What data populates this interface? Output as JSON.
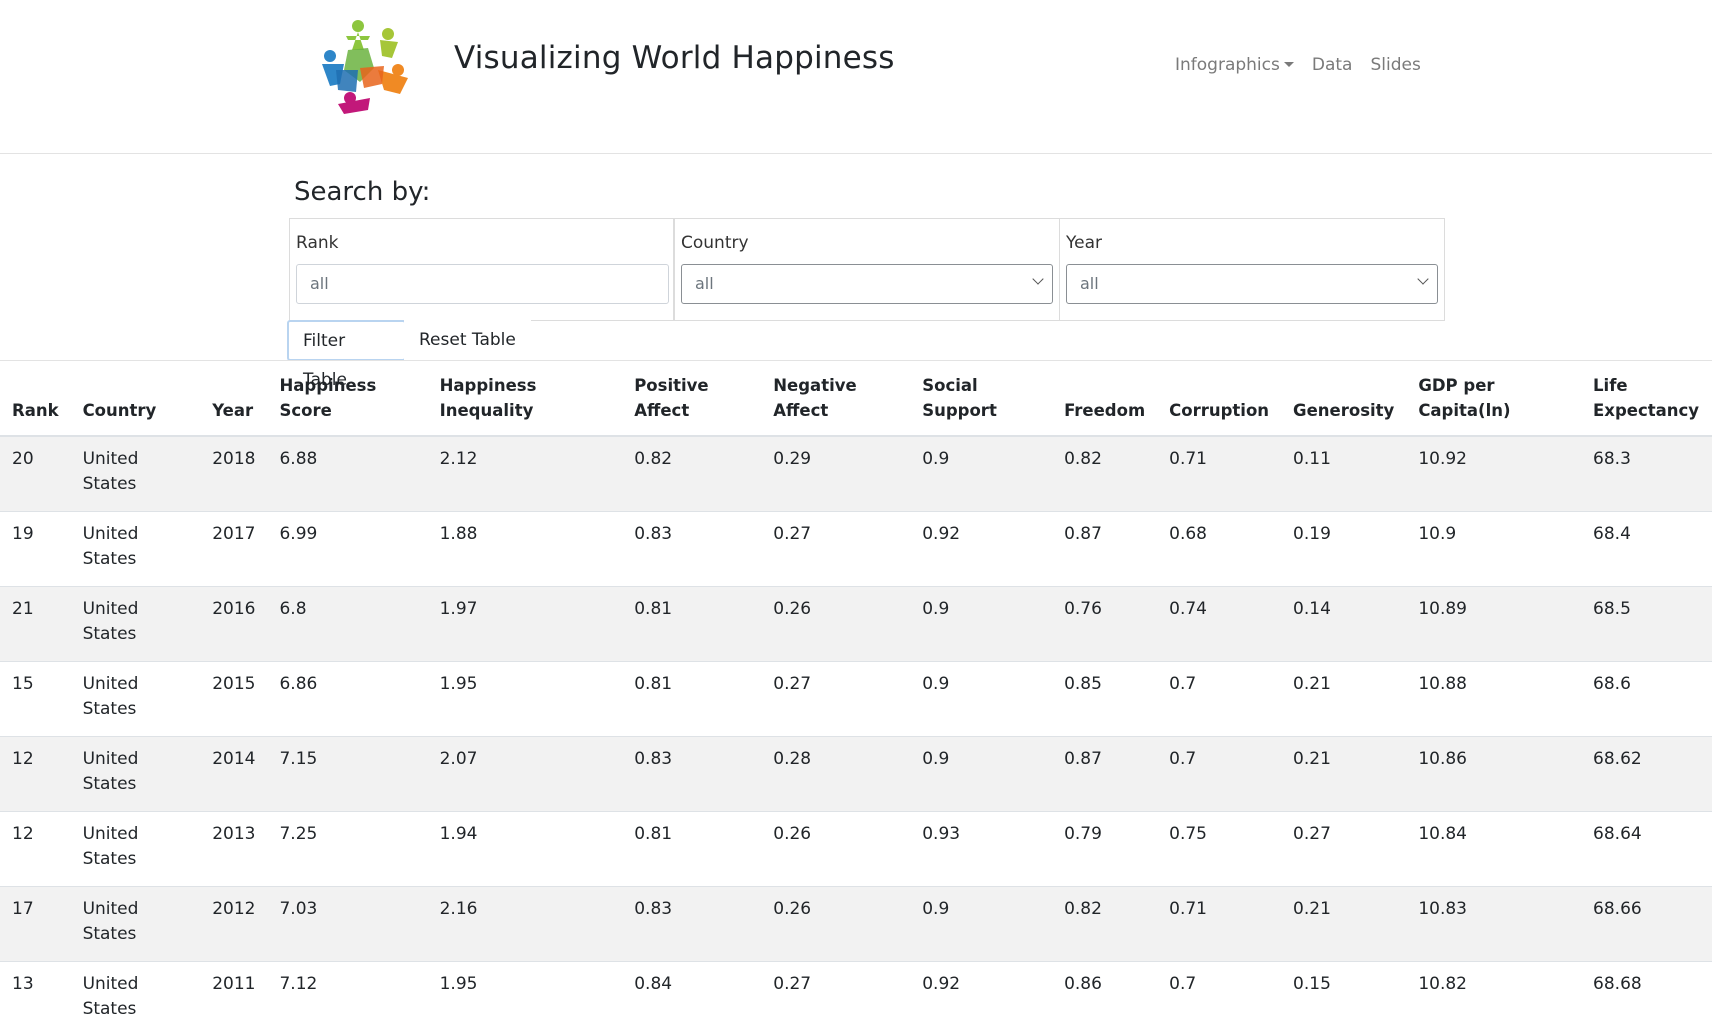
{
  "site": {
    "title": "Visualizing World Happiness",
    "logo": "people-circle-logo"
  },
  "nav": {
    "infographics": "Infographics",
    "data": "Data",
    "slides": "Slides"
  },
  "search": {
    "heading": "Search by:",
    "rank_label": "Rank",
    "rank_placeholder": "all",
    "country_label": "Country",
    "country_value": "all",
    "year_label": "Year",
    "year_value": "all",
    "filter_button": "Filter Table",
    "reset_button": "Reset Table"
  },
  "table": {
    "headers": [
      "Rank",
      "Country",
      "Year",
      "Happiness Score",
      "Happiness Inequality",
      "Positive Affect",
      "Negative Affect",
      "Social Support",
      "Freedom",
      "Corruption",
      "Generosity",
      "GDP per Capita(ln)",
      "Life Expectancy"
    ],
    "rows": [
      [
        "20",
        "United States",
        "2018",
        "6.88",
        "2.12",
        "0.82",
        "0.29",
        "0.9",
        "0.82",
        "0.71",
        "0.11",
        "10.92",
        "68.3"
      ],
      [
        "19",
        "United States",
        "2017",
        "6.99",
        "1.88",
        "0.83",
        "0.27",
        "0.92",
        "0.87",
        "0.68",
        "0.19",
        "10.9",
        "68.4"
      ],
      [
        "21",
        "United States",
        "2016",
        "6.8",
        "1.97",
        "0.81",
        "0.26",
        "0.9",
        "0.76",
        "0.74",
        "0.14",
        "10.89",
        "68.5"
      ],
      [
        "15",
        "United States",
        "2015",
        "6.86",
        "1.95",
        "0.81",
        "0.27",
        "0.9",
        "0.85",
        "0.7",
        "0.21",
        "10.88",
        "68.6"
      ],
      [
        "12",
        "United States",
        "2014",
        "7.15",
        "2.07",
        "0.83",
        "0.28",
        "0.9",
        "0.87",
        "0.7",
        "0.21",
        "10.86",
        "68.62"
      ],
      [
        "12",
        "United States",
        "2013",
        "7.25",
        "1.94",
        "0.81",
        "0.26",
        "0.93",
        "0.79",
        "0.75",
        "0.27",
        "10.84",
        "68.64"
      ],
      [
        "17",
        "United States",
        "2012",
        "7.03",
        "2.16",
        "0.83",
        "0.26",
        "0.9",
        "0.82",
        "0.71",
        "0.21",
        "10.83",
        "68.66"
      ],
      [
        "13",
        "United States",
        "2011",
        "7.12",
        "1.95",
        "0.84",
        "0.27",
        "0.92",
        "0.86",
        "0.7",
        "0.15",
        "10.82",
        "68.68"
      ]
    ]
  }
}
